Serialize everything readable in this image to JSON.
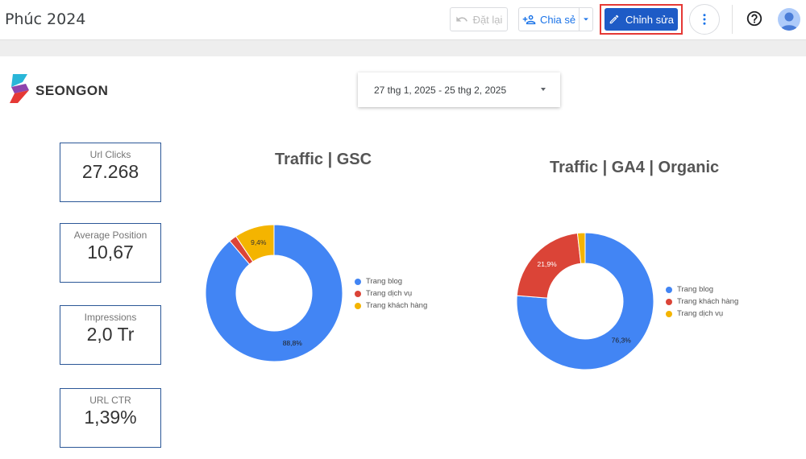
{
  "header": {
    "title": "Phúc 2024",
    "reset_label": "Đặt lại",
    "share_label": "Chia sẻ",
    "edit_label": "Chỉnh sửa"
  },
  "brand": {
    "name": "SEONGON"
  },
  "date_range": {
    "value": "27 thg 1, 2025 - 25 thg 2, 2025"
  },
  "kpis": [
    {
      "label": "Url Clicks",
      "value": "27.268"
    },
    {
      "label": "Average Position",
      "value": "10,67"
    },
    {
      "label": "Impressions",
      "value": "2,0 Tr"
    },
    {
      "label": "URL CTR",
      "value": "1,39%"
    }
  ],
  "colors": {
    "blue": "#4285f4",
    "red": "#db4437",
    "yellow": "#f4b400",
    "primary": "#1e5bc6",
    "highlight": "#e53935"
  },
  "chart_data": [
    {
      "type": "pie",
      "title": "Traffic | GSC",
      "series": [
        {
          "name": "Trang blog",
          "value": 88.8,
          "label": "88,8%",
          "color": "#4285f4"
        },
        {
          "name": "Trang dịch vụ",
          "value": 1.8,
          "label": "",
          "color": "#db4437"
        },
        {
          "name": "Trang khách hàng",
          "value": 9.4,
          "label": "9,4%",
          "color": "#f4b400"
        }
      ],
      "legend_position": "right"
    },
    {
      "type": "pie",
      "title": "Traffic | GA4 | Organic",
      "series": [
        {
          "name": "Trang blog",
          "value": 76.3,
          "label": "76,3%",
          "color": "#4285f4"
        },
        {
          "name": "Trang khách hàng",
          "value": 21.9,
          "label": "21,9%",
          "color": "#db4437"
        },
        {
          "name": "Trang dịch vụ",
          "value": 1.8,
          "label": "",
          "color": "#f4b400"
        }
      ],
      "legend_position": "right"
    }
  ]
}
